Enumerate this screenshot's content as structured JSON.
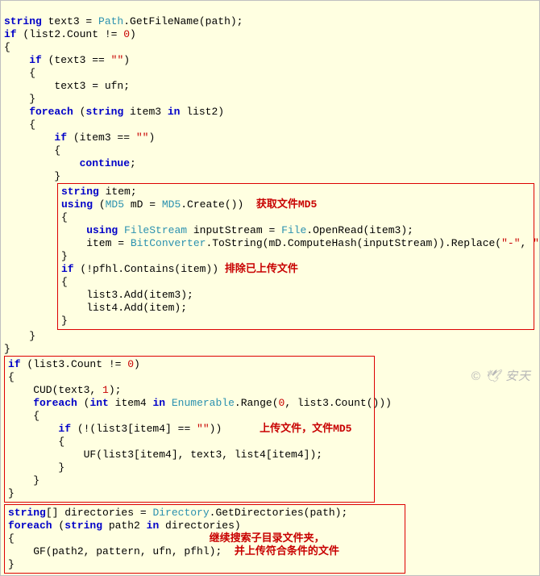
{
  "line1a": "string",
  "line1b": " text3 = ",
  "line1c": "Path",
  "line1d": ".GetFileName(path);",
  "line2a": "if",
  "line2b": " (list2.Count != ",
  "line2c": "0",
  "line2d": ")",
  "line3": "{",
  "line4a": "    if",
  "line4b": " (text3 == ",
  "line4c": "\"\"",
  "line4d": ")",
  "line5": "    {",
  "line6": "        text3 = ufn;",
  "line7": "    }",
  "line8a": "    foreach",
  "line8b": " (",
  "line8c": "string",
  "line8d": " item3 ",
  "line8e": "in",
  "line8f": " list2)",
  "line9": "    {",
  "line10a": "        if",
  "line10b": " (item3 == ",
  "line10c": "\"\"",
  "line10d": ")",
  "line11": "        {",
  "line12a": "            continue",
  "line12b": ";",
  "line13": "        }",
  "b1_l1a": "string",
  "b1_l1b": " item;",
  "b1_l2a": "using",
  "b1_l2b": " (",
  "b1_l2c": "MD5",
  "b1_l2d": " mD = ",
  "b1_l2e": "MD5",
  "b1_l2f": ".Create())  ",
  "b1_l2g": "获取文件MD5",
  "b1_l3": "{",
  "b1_l4a": "    using",
  "b1_l4b": " ",
  "b1_l4c": "FileStream",
  "b1_l4d": " inputStream = ",
  "b1_l4e": "File",
  "b1_l4f": ".OpenRead(item3);",
  "b1_l5a": "    item = ",
  "b1_l5b": "BitConverter",
  "b1_l5c": ".ToString(mD.ComputeHash(inputStream)).Replace(",
  "b1_l5d": "\"-\"",
  "b1_l5e": ", ",
  "b1_l5f": "\"\"",
  "b1_l5g": ");",
  "b1_l6": "}",
  "b1_l7a": "if",
  "b1_l7b": " (!pfhl.Contains(item)) ",
  "b1_l7c": "排除已上传文件",
  "b1_l8": "{",
  "b1_l9": "    list3.Add(item3);",
  "b1_l10": "    list4.Add(item);",
  "b1_l11": "}",
  "line14": "    }",
  "line15": "}",
  "b2_l1a": "if",
  "b2_l1b": " (list3.Count != ",
  "b2_l1c": "0",
  "b2_l1d": ")",
  "b2_l2": "{",
  "b2_l3a": "    CUD(text3, ",
  "b2_l3b": "1",
  "b2_l3c": ");",
  "b2_l4a": "    foreach",
  "b2_l4b": " (",
  "b2_l4c": "int",
  "b2_l4d": " item4 ",
  "b2_l4e": "in",
  "b2_l4f": " ",
  "b2_l4g": "Enumerable",
  "b2_l4h": ".Range(",
  "b2_l4i": "0",
  "b2_l4j": ", list3.Count()))",
  "b2_l5": "    {",
  "b2_l6a": "        if",
  "b2_l6b": " (!(list3[item4] == ",
  "b2_l6c": "\"\"",
  "b2_l6d": "))      ",
  "b2_l6e": "上传文件，文件MD5",
  "b2_l7": "        {",
  "b2_l8": "            UF(list3[item4], text3, list4[item4]);",
  "b2_l9": "        }",
  "b2_l10": "    }",
  "b2_l11": "}",
  "b3_l1a": "string",
  "b3_l1b": "[] directories = ",
  "b3_l1c": "Directory",
  "b3_l1d": ".GetDirectories(path);",
  "b3_l2a": "foreach",
  "b3_l2b": " (",
  "b3_l2c": "string",
  "b3_l2d": " path2 ",
  "b3_l2e": "in",
  "b3_l2f": " directories)",
  "b3_l3a": "{                               ",
  "b3_l3b": "继续搜索子目录文件夹，",
  "b3_l4a": "    GF(path2, pattern, ufn, pfhl);  ",
  "b3_l4b": "并上传符合条件的文件",
  "b3_l5": "}",
  "watermark": "© 🕊 安天"
}
